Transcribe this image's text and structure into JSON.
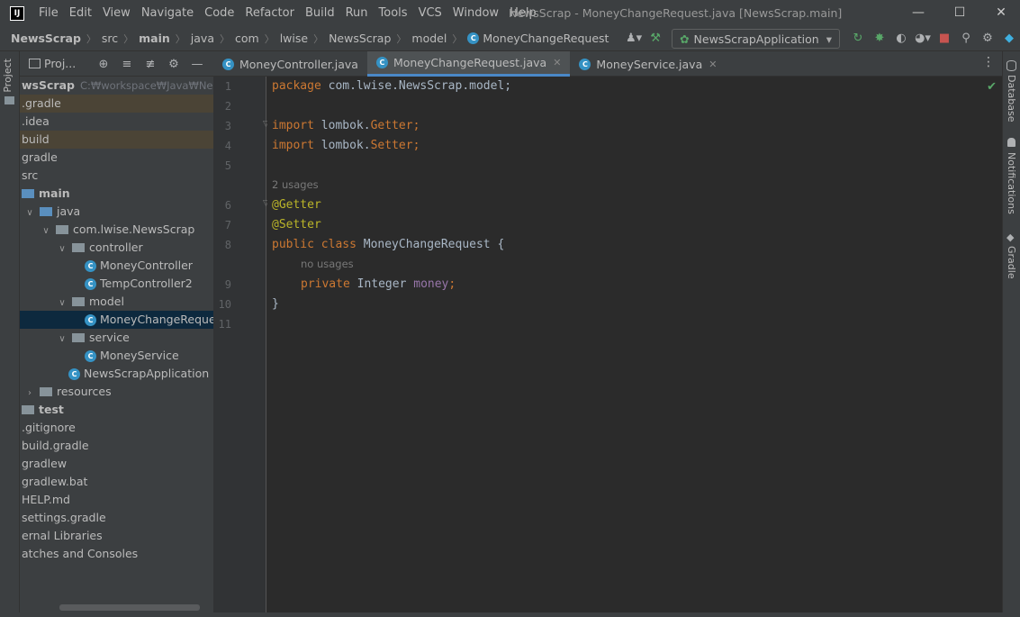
{
  "window": {
    "title": "NewsScrap - MoneyChangeRequest.java [NewsScrap.main]",
    "logo": "IJ",
    "controls": {
      "minimize": "—",
      "maximize": "☐",
      "close": "✕"
    }
  },
  "menu": [
    "File",
    "Edit",
    "View",
    "Navigate",
    "Code",
    "Refactor",
    "Build",
    "Run",
    "Tools",
    "VCS",
    "Window",
    "Help"
  ],
  "breadcrumb": [
    "NewsScrap",
    "src",
    "main",
    "java",
    "com",
    "lwise",
    "NewsScrap",
    "model",
    "MoneyChangeRequest"
  ],
  "toolbar": {
    "run_config": "NewsScrapApplication",
    "icons": [
      "user-icon",
      "hammer-icon",
      "run-icon",
      "debug-icon",
      "coverage-icon",
      "profile-icon",
      "stop-icon",
      "search-icon",
      "gear-icon",
      "toolbox-icon"
    ]
  },
  "left_strip": {
    "project_tab": "Project"
  },
  "right_strip": [
    "Database",
    "Notifications",
    "Gradle"
  ],
  "project_panel": {
    "title": "Proj...",
    "tree": [
      {
        "label": "wsScrap",
        "extra": "C:₩workspace₩Java₩NewsScrap",
        "indent": 0,
        "bold": true,
        "style": ""
      },
      {
        "label": ".gradle",
        "indent": 0,
        "style": "hl-brown"
      },
      {
        "label": ".idea",
        "indent": 0,
        "style": ""
      },
      {
        "label": "build",
        "indent": 0,
        "style": "hl-brown"
      },
      {
        "label": "gradle",
        "indent": 0,
        "style": ""
      },
      {
        "label": "src",
        "indent": 0,
        "style": ""
      },
      {
        "label": "main",
        "indent": 0,
        "bold": true,
        "folder": "blue",
        "style": ""
      },
      {
        "label": "java",
        "indent": 1,
        "arrow": "open",
        "folder": "blue",
        "style": ""
      },
      {
        "label": "com.lwise.NewsScrap",
        "indent": 2,
        "arrow": "open",
        "folder": "pkg",
        "style": ""
      },
      {
        "label": "controller",
        "indent": 3,
        "arrow": "open",
        "folder": "pkg",
        "style": ""
      },
      {
        "label": "MoneyController",
        "indent": 4,
        "class": true,
        "style": ""
      },
      {
        "label": "TempController2",
        "indent": 4,
        "class": true,
        "style": ""
      },
      {
        "label": "model",
        "indent": 3,
        "arrow": "open",
        "folder": "pkg",
        "style": ""
      },
      {
        "label": "MoneyChangeRequest",
        "indent": 4,
        "class": true,
        "style": "selected"
      },
      {
        "label": "service",
        "indent": 3,
        "arrow": "open",
        "folder": "pkg",
        "style": ""
      },
      {
        "label": "MoneyService",
        "indent": 4,
        "class": true,
        "style": ""
      },
      {
        "label": "NewsScrapApplication",
        "indent": 3,
        "class": true,
        "style": ""
      },
      {
        "label": "resources",
        "indent": 1,
        "arrow": "closed",
        "folder": "pkg",
        "style": ""
      },
      {
        "label": "test",
        "indent": 0,
        "bold": true,
        "folder": "pkg",
        "style": ""
      },
      {
        "label": ".gitignore",
        "indent": 0,
        "style": ""
      },
      {
        "label": "build.gradle",
        "indent": 0,
        "style": ""
      },
      {
        "label": "gradlew",
        "indent": 0,
        "style": ""
      },
      {
        "label": "gradlew.bat",
        "indent": 0,
        "style": ""
      },
      {
        "label": "HELP.md",
        "indent": 0,
        "style": ""
      },
      {
        "label": "settings.gradle",
        "indent": 0,
        "style": ""
      },
      {
        "label": "ernal Libraries",
        "indent": 0,
        "style": ""
      },
      {
        "label": "atches and Consoles",
        "indent": 0,
        "style": ""
      }
    ]
  },
  "editor": {
    "tabs": [
      {
        "label": "MoneyController.java",
        "active": false
      },
      {
        "label": "MoneyChangeRequest.java",
        "active": true
      },
      {
        "label": "MoneyService.java",
        "active": false
      }
    ],
    "line_numbers": [
      "1",
      "2",
      "3",
      "4",
      "5",
      "6",
      "7",
      "8",
      "9",
      "10",
      "11"
    ],
    "hints": {
      "usages": "2 usages",
      "no_usages": "no usages"
    },
    "code": {
      "l1_kw": "package",
      "l1_rest": " com.lwise.NewsScrap.model;",
      "l3_kw": "import",
      "l3_pkg": " lombok.",
      "l3_cls": "Getter",
      "l3_end": ";",
      "l4_kw": "import",
      "l4_pkg": " lombok.",
      "l4_cls": "Setter",
      "l4_end": ";",
      "l6": "@Getter",
      "l7": "@Setter",
      "l8_kw": "public class",
      "l8_rest": " MoneyChangeRequest {",
      "l9_kw": "private",
      "l9_type": " Integer ",
      "l9_field": "money",
      "l9_end": ";",
      "l10": "}"
    }
  }
}
